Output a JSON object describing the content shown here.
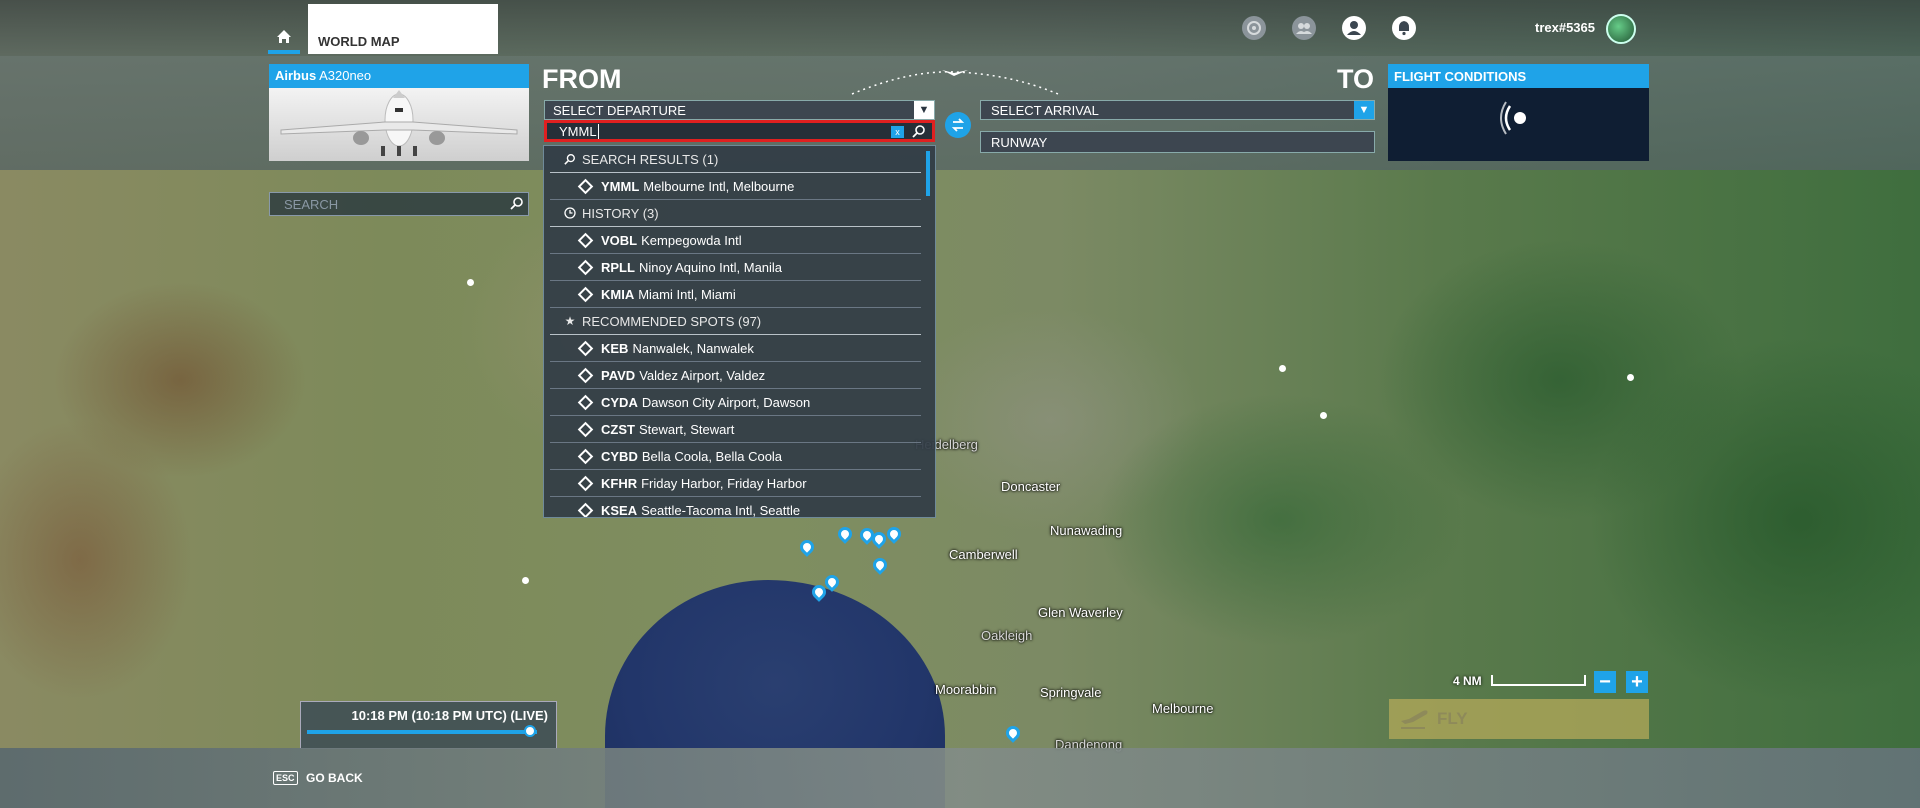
{
  "topbar": {
    "world_map_tab": "WORLD MAP",
    "username": "trex#5365",
    "icons": [
      "home-icon",
      "achievements-icon",
      "friends-icon",
      "profile-icon",
      "notifications-icon"
    ]
  },
  "aircraft": {
    "brand": "Airbus",
    "model": "A320neo"
  },
  "route": {
    "from_label": "FROM",
    "to_label": "TO",
    "departure_placeholder": "SELECT DEPARTURE",
    "arrival_placeholder": "SELECT ARRIVAL",
    "runway_label": "RUNWAY",
    "search_value": "YMML",
    "clear_label": "x"
  },
  "flight_conditions": {
    "title": "FLIGHT CONDITIONS"
  },
  "map_search": {
    "placeholder": "SEARCH"
  },
  "results": {
    "search_header": "SEARCH RESULTS (1)",
    "search_items": [
      {
        "code": "YMML",
        "name": "Melbourne Intl, Melbourne"
      }
    ],
    "history_header": "HISTORY (3)",
    "history_items": [
      {
        "code": "VOBL",
        "name": "Kempegowda Intl"
      },
      {
        "code": "RPLL",
        "name": "Ninoy Aquino Intl, Manila"
      },
      {
        "code": "KMIA",
        "name": "Miami Intl, Miami"
      }
    ],
    "recommended_header": "RECOMMENDED SPOTS (97)",
    "recommended_items": [
      {
        "code": "KEB",
        "name": "Nanwalek, Nanwalek"
      },
      {
        "code": "PAVD",
        "name": "Valdez Airport, Valdez"
      },
      {
        "code": "CYDA",
        "name": "Dawson City Airport, Dawson"
      },
      {
        "code": "CZST",
        "name": "Stewart, Stewart"
      },
      {
        "code": "CYBD",
        "name": "Bella Coola, Bella Coola"
      },
      {
        "code": "KFHR",
        "name": "Friday Harbor, Friday Harbor"
      },
      {
        "code": "KSEA",
        "name": "Seattle-Tacoma Intl, Seattle"
      }
    ]
  },
  "map_labels": {
    "heidelberg": "Heidelberg",
    "doncaster": "Doncaster",
    "nunawading": "Nunawading",
    "camberwell": "Camberwell",
    "glen_waverley": "Glen Waverley",
    "oakleigh": "Oakleigh",
    "moorabbin": "Moorabbin",
    "springvale": "Springvale",
    "melbourne": "Melbourne",
    "dandenong": "Dandenong"
  },
  "time": {
    "display": "10:18 PM (10:18 PM UTC) (LIVE)",
    "progress": 0.97
  },
  "scale": {
    "label": "4 NM"
  },
  "zoom": {
    "out": "−",
    "in": "+"
  },
  "fly": {
    "label": "FLY"
  },
  "footer": {
    "esc_key": "ESC",
    "go_back": "GO BACK"
  },
  "colors": {
    "accent": "#1fa3e8",
    "highlight_border": "#e02020",
    "fly_button": "#b4aa5a"
  }
}
